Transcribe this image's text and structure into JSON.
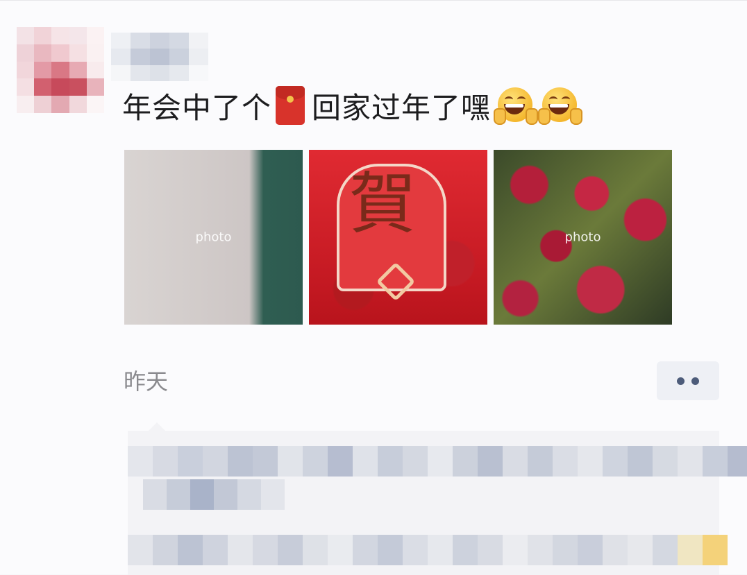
{
  "post": {
    "caption_text": "年会中了个",
    "caption_text_2": "回家过年了嘿",
    "time": "昨天",
    "caption_emoji": [
      "red-envelope",
      "grinning-face-with-hands"
    ],
    "photos": [
      {
        "placeholder": "photo"
      },
      {
        "placeholder": ""
      },
      {
        "placeholder": "photo"
      }
    ],
    "envelope_character": "賀"
  },
  "colors": {
    "caption": "#1d1d1f",
    "time": "#8a8a8e",
    "more_dots": "#4d5c7a",
    "comment_bg": "#f3f3f6"
  }
}
